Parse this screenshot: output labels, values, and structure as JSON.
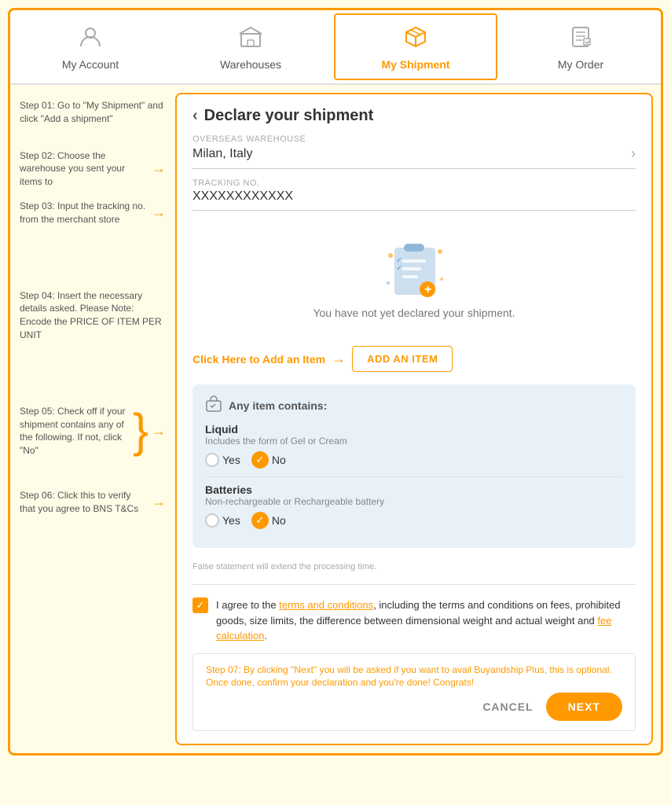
{
  "nav": {
    "items": [
      {
        "id": "my-account",
        "label": "My Account",
        "icon": "👤",
        "active": false
      },
      {
        "id": "warehouses",
        "label": "Warehouses",
        "icon": "🏬",
        "active": false
      },
      {
        "id": "my-shipment",
        "label": "My Shipment",
        "icon": "📦",
        "active": true
      },
      {
        "id": "my-order",
        "label": "My Order",
        "icon": "📋",
        "active": false
      }
    ]
  },
  "sidebar": {
    "step01": "Step 01: Go to \"My Shipment\" and click \"Add a shipment\"",
    "step02": "Step 02: Choose the warehouse you sent your items to",
    "step03": "Step 03: Input the tracking no. from the merchant store",
    "step04": "Step 04: Insert the necessary details asked. Please Note: Encode the PRICE OF ITEM PER UNIT",
    "step05_pre": "Step 05: Check off if your shipment contains any of the following. If not, click \"No\"",
    "step06": "Step 06: Click this to verify that you agree to BNS T&Cs",
    "step07": "Step 07: By clicking \"Next\" you will be asked if you want to avail Buyandship Plus, this is optional. Once done, confirm your declaration and you're done! Congrats!"
  },
  "page": {
    "title": "Declare your shipment",
    "warehouse_label": "OVERSEAS WAREHOUSE",
    "warehouse_value": "Milan, Italy",
    "tracking_label": "TRACKING NO.",
    "tracking_value": "XXXXXXXXXXXX",
    "empty_state_text": "You have not yet declared your shipment.",
    "add_item_hint": "Click Here to Add an Item",
    "add_item_btn": "ADD AN ITEM",
    "contains_header": "Any item contains:",
    "liquid_label": "Liquid",
    "liquid_desc": "Includes the form of Gel or Cream",
    "liquid_yes": "Yes",
    "liquid_no": "No",
    "batteries_label": "Batteries",
    "batteries_desc": "Non-rechargeable or Rechargeable battery",
    "batteries_yes": "Yes",
    "batteries_no": "No",
    "false_statement": "False statement will extend the processing time.",
    "tnc_text1": "I agree to the ",
    "tnc_link1": "terms and conditions",
    "tnc_text2": ", including the terms and conditions on fees, prohibited goods, size limits, the difference between dimensional weight and actual weight and ",
    "tnc_link2": "fee calculation",
    "tnc_text3": ".",
    "cancel_label": "CANCEL",
    "next_label": "NEXT"
  },
  "colors": {
    "orange": "#f90",
    "light_blue_bg": "#e8f0f8"
  }
}
